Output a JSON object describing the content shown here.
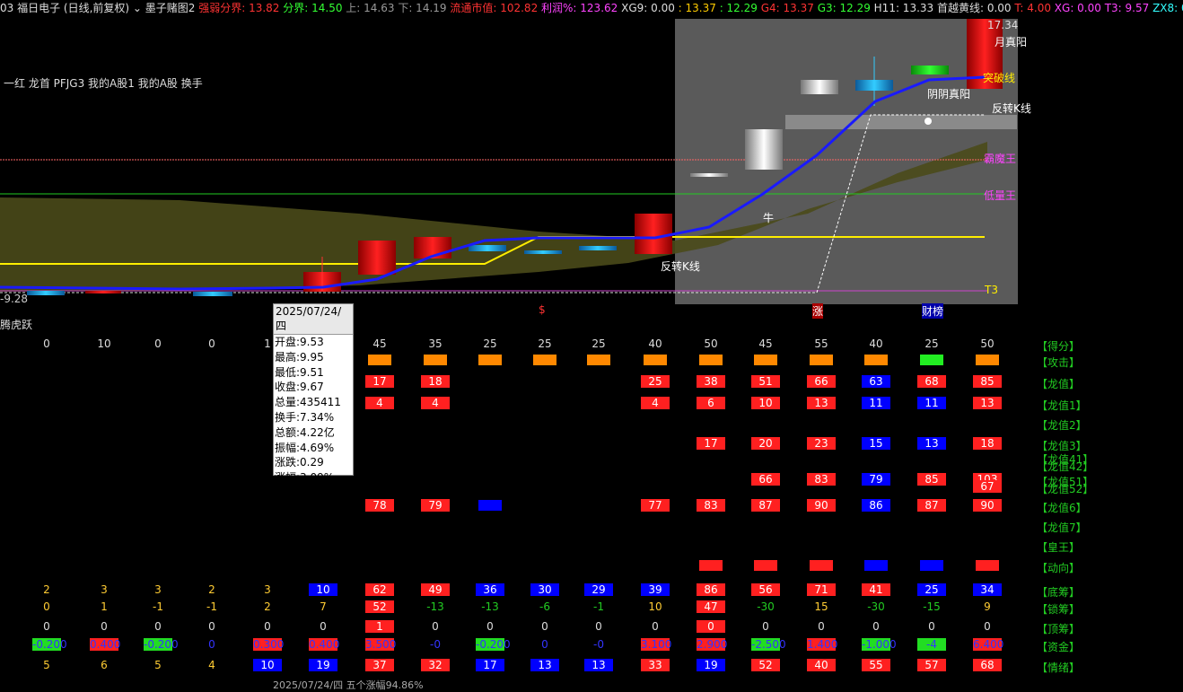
{
  "topbar": {
    "items": [
      {
        "text": "03 福日电子 (日线,前复权)",
        "color": "#dddddd"
      },
      {
        "text": "⌄ 墨子赌图2",
        "color": "#dddddd"
      },
      {
        "text": "强弱分界: 13.82",
        "color": "#ff3333"
      },
      {
        "text": "分界: 14.50",
        "color": "#33ff33"
      },
      {
        "text": "上: 14.63",
        "color": "#999999"
      },
      {
        "text": "下: 14.19",
        "color": "#999999"
      },
      {
        "text": "流通市值: 102.82",
        "color": "#ff3333"
      },
      {
        "text": "利润%: 123.62",
        "color": "#ff44ff"
      },
      {
        "text": "XG9: 0.00",
        "color": "#dddddd"
      },
      {
        "text": ": 13.37",
        "color": "#ffcc00"
      },
      {
        "text": ": 12.29",
        "color": "#33ff33"
      },
      {
        "text": "G4: 13.37",
        "color": "#ff3333"
      },
      {
        "text": "G3: 12.29",
        "color": "#33ff33"
      },
      {
        "text": "H11: 13.33",
        "color": "#dddddd"
      },
      {
        "text": "首越黄线: 0.00",
        "color": "#dddddd"
      },
      {
        "text": "T: 4.00",
        "color": "#ff3333"
      },
      {
        "text": "XG: 0.00",
        "color": "#ff44ff"
      },
      {
        "text": "T3: 9.57",
        "color": "#ff44ff"
      },
      {
        "text": "ZX8: 0.00",
        "color": "#33ffff"
      },
      {
        "text": ": 16.6",
        "color": "#ff3333"
      }
    ]
  },
  "chart": {
    "tags_label": "一红 龙首 PFJG3 我的A股1 我的A股 换手",
    "price_low_label": "-9.28",
    "price_high_label": "17.34",
    "annotations": {
      "yuezhenyang": "月真阳",
      "tupoxian": "突破线",
      "yinzhenyang": "阴阴真阳",
      "fanzhuan1": "反转K线",
      "fanzhuan2": "反转K线",
      "bamowang": "霸魔王",
      "dishiwang": "低量王",
      "niu": "牛",
      "t3": "T3"
    },
    "bottom_markers": {
      "s": "$",
      "zhang": "涨",
      "caibang": "财榜"
    }
  },
  "tooltip": {
    "date": "2025/07/24/四",
    "lines": [
      "开盘:9.53",
      "最高:9.95",
      "最低:9.51",
      "收盘:9.67",
      "总量:435411",
      "换手:7.34%",
      "总额:4.22亿",
      "振幅:4.69%",
      "涨跌:0.29",
      "涨幅:3.09%"
    ]
  },
  "lower": {
    "title": "腾虎跃",
    "row_labels": [
      "【得分】",
      "【攻击】",
      "【龙值】",
      "【龙值1】",
      "【龙值2】",
      "【龙值3】",
      "【龙值41】",
      "【龙值42】",
      "【龙值51】",
      "【龙值52】",
      "【龙值6】",
      "【龙值7】",
      "【皇王】",
      "【动向】",
      "【底筹】",
      "【锁筹】",
      "【顶筹】",
      "【资金】",
      "【情绪】"
    ],
    "score_row": [
      "0",
      "10",
      "0",
      "0",
      "1",
      "45",
      "35",
      "25",
      "25",
      "25",
      "40",
      "50",
      "45",
      "55",
      "40",
      "25",
      "50"
    ],
    "longzhi_row": [
      "17",
      "18",
      "",
      "25",
      "38",
      "51",
      "66",
      "63",
      "68",
      "85"
    ],
    "longzhi1_row": [
      "4",
      "4",
      "4",
      "6",
      "10",
      "13",
      "11",
      "11",
      "13"
    ],
    "longzhi3_row": [
      "17",
      "20",
      "23",
      "15",
      "13",
      "18"
    ],
    "longzhi5_row": [
      "66",
      "83",
      "79",
      "85",
      "103",
      "67"
    ],
    "longzhi6_row": [
      "78",
      "79",
      "77",
      "83",
      "87",
      "90",
      "86",
      "87",
      "90"
    ],
    "dichou_row": [
      "2",
      "3",
      "3",
      "2",
      "3",
      "10",
      "62",
      "49",
      "36",
      "30",
      "29",
      "39",
      "86",
      "56",
      "71",
      "41",
      "25",
      "34"
    ],
    "suochou_row": [
      "0",
      "1",
      "-1",
      "-1",
      "2",
      "7",
      "52",
      "-13",
      "-13",
      "-6",
      "-1",
      "10",
      "47",
      "-30",
      "15",
      "-30",
      "-15",
      "9"
    ],
    "dingchou_row": [
      "0",
      "0",
      "0",
      "0",
      "0",
      "0",
      "1",
      "0",
      "0",
      "0",
      "0",
      "0",
      "0",
      "0",
      "0",
      "0",
      "0",
      "0"
    ],
    "zijin_row": [
      "-0.200",
      "0.400",
      "-0.200",
      "0",
      "0.300",
      "0.400",
      "3.500",
      "-0",
      "-0.200",
      "0",
      "-0",
      "3.100",
      "2.900",
      "-2.500",
      "1.400",
      "-1.000",
      "-4",
      "6.400"
    ],
    "qingxu_row": [
      "5",
      "6",
      "5",
      "4",
      "10",
      "19",
      "37",
      "32",
      "17",
      "13",
      "13",
      "33",
      "19",
      "52",
      "40",
      "55",
      "57",
      "68"
    ],
    "footer": "2025/07/24/四  五个涨幅94.86%"
  }
}
